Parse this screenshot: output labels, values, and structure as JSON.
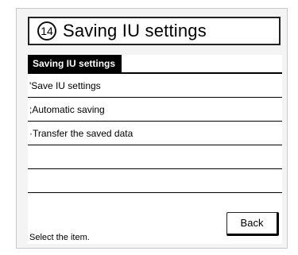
{
  "header": {
    "number": "14",
    "title": "Saving IU settings"
  },
  "tab": {
    "label": "Saving IU settings"
  },
  "menu": {
    "items": [
      "'Save IU settings",
      ";Automatic saving",
      "·Transfer the saved data",
      "",
      ""
    ]
  },
  "buttons": {
    "back": "Back"
  },
  "status": {
    "text": "Select the item."
  }
}
